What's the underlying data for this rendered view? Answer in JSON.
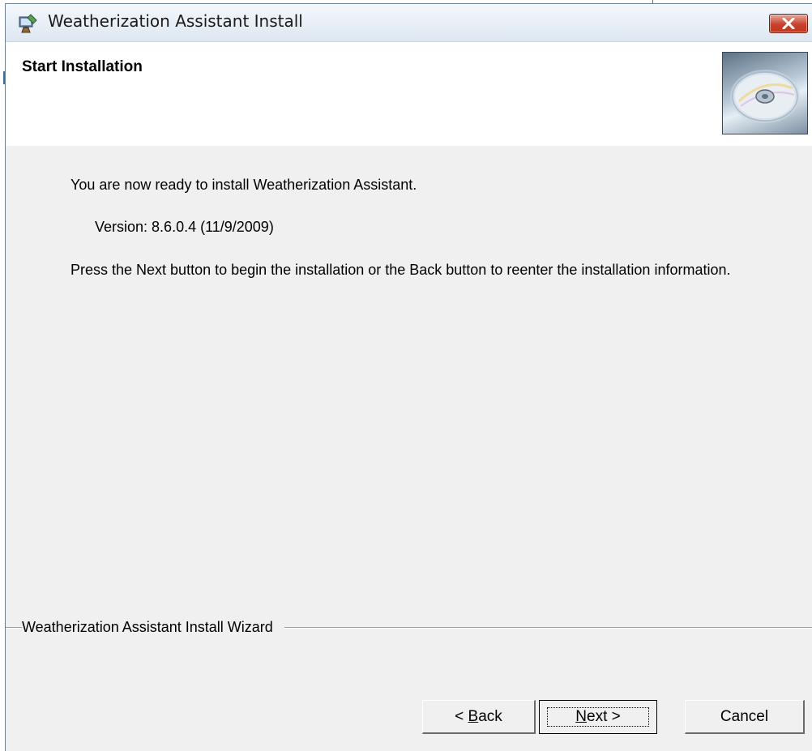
{
  "window": {
    "title": "Weatherization Assistant Install"
  },
  "header": {
    "title": "Start Installation",
    "image_icon": "cd-disc-icon"
  },
  "content": {
    "ready_text": "You are now ready to install Weatherization Assistant.",
    "version_text": "Version: 8.6.0.4 (11/9/2009)",
    "instructions_text": "Press the Next button to begin the installation or the Back button to reenter the installation information."
  },
  "footer": {
    "group_label": "Weatherization Assistant Install Wizard",
    "back": {
      "prefix": "< ",
      "mnemonic": "B",
      "rest": "ack"
    },
    "next": {
      "mnemonic": "N",
      "rest": "ext >"
    },
    "cancel_label": "Cancel"
  },
  "colors": {
    "dialog_bg": "#f0f0f0",
    "header_bg": "#ffffff",
    "close_button": "#c7422c"
  }
}
